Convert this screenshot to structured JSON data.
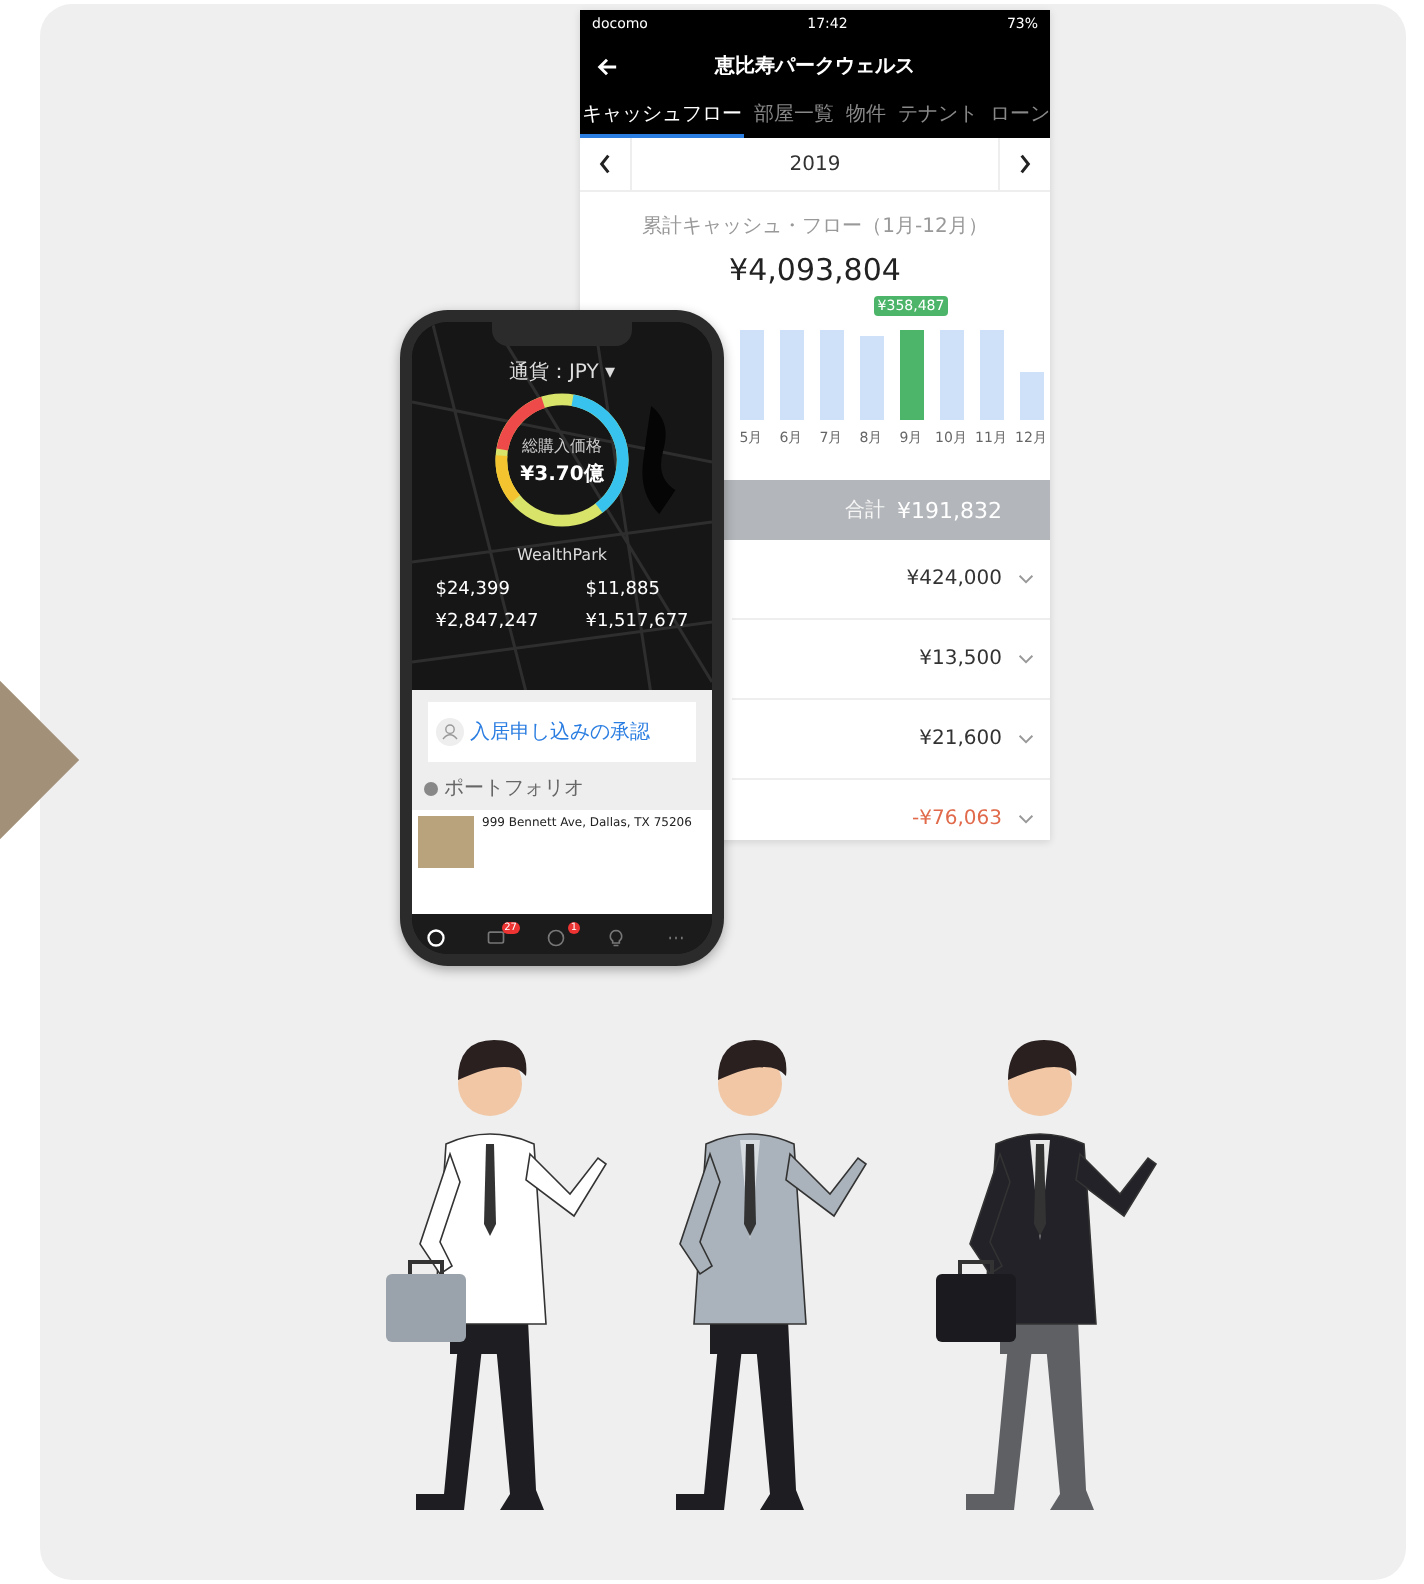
{
  "screenshot": {
    "status_bar": {
      "carrier": "docomo",
      "time": "17:42",
      "battery": "73%"
    },
    "title": "恵比寿パークウェルス",
    "tabs": [
      {
        "label": "キャッシュフロー",
        "selected": true
      },
      {
        "label": "部屋一覧",
        "selected": false
      },
      {
        "label": "物件",
        "selected": false
      },
      {
        "label": "テナント",
        "selected": false
      },
      {
        "label": "ローン",
        "selected": false
      }
    ],
    "year": "2019",
    "summary_label": "累計キャッシュ・フロー（1月-12月）",
    "total": "¥4,093,804",
    "highlight_value": "¥358,487",
    "months": [
      {
        "label": "5月",
        "selected": false
      },
      {
        "label": "6月",
        "selected": false
      },
      {
        "label": "7月",
        "selected": false
      },
      {
        "label": "8月",
        "selected": false
      },
      {
        "label": "9月",
        "selected": true
      },
      {
        "label": "10月",
        "selected": false
      },
      {
        "label": "11月",
        "selected": false
      },
      {
        "label": "12月",
        "selected": false
      }
    ],
    "subtotal": {
      "label": "合計",
      "value": "¥191,832"
    },
    "rows": [
      {
        "amount": "¥424,000",
        "negative": false
      },
      {
        "amount": "¥13,500",
        "negative": false
      },
      {
        "amount": "¥21,600",
        "negative": false
      },
      {
        "amount": "-¥76,063",
        "negative": true
      }
    ]
  },
  "phone": {
    "currency": "通貨：JPY ▾",
    "ring_label": "総購入価格",
    "ring_value": "¥3.70億",
    "brand": "WealthPark",
    "stats": [
      {
        "usd": "$24,399",
        "jpy": "¥2,847,247"
      },
      {
        "usd": "$11,885",
        "jpy": "¥1,517,677"
      }
    ],
    "notice": {
      "title": "入居申し込みの承認"
    },
    "portfolio_label": "ポートフォリオ",
    "property": {
      "address": "999 Bennett Ave, Dallas, TX 75206"
    },
    "tabs": [
      {
        "kind": "portfolio",
        "selected": true
      },
      {
        "kind": "chat",
        "badge": "27",
        "selected": false
      },
      {
        "kind": "activity",
        "badge": "1",
        "selected": false
      },
      {
        "kind": "discovery",
        "selected": false
      },
      {
        "kind": "more",
        "selected": false
      }
    ]
  }
}
